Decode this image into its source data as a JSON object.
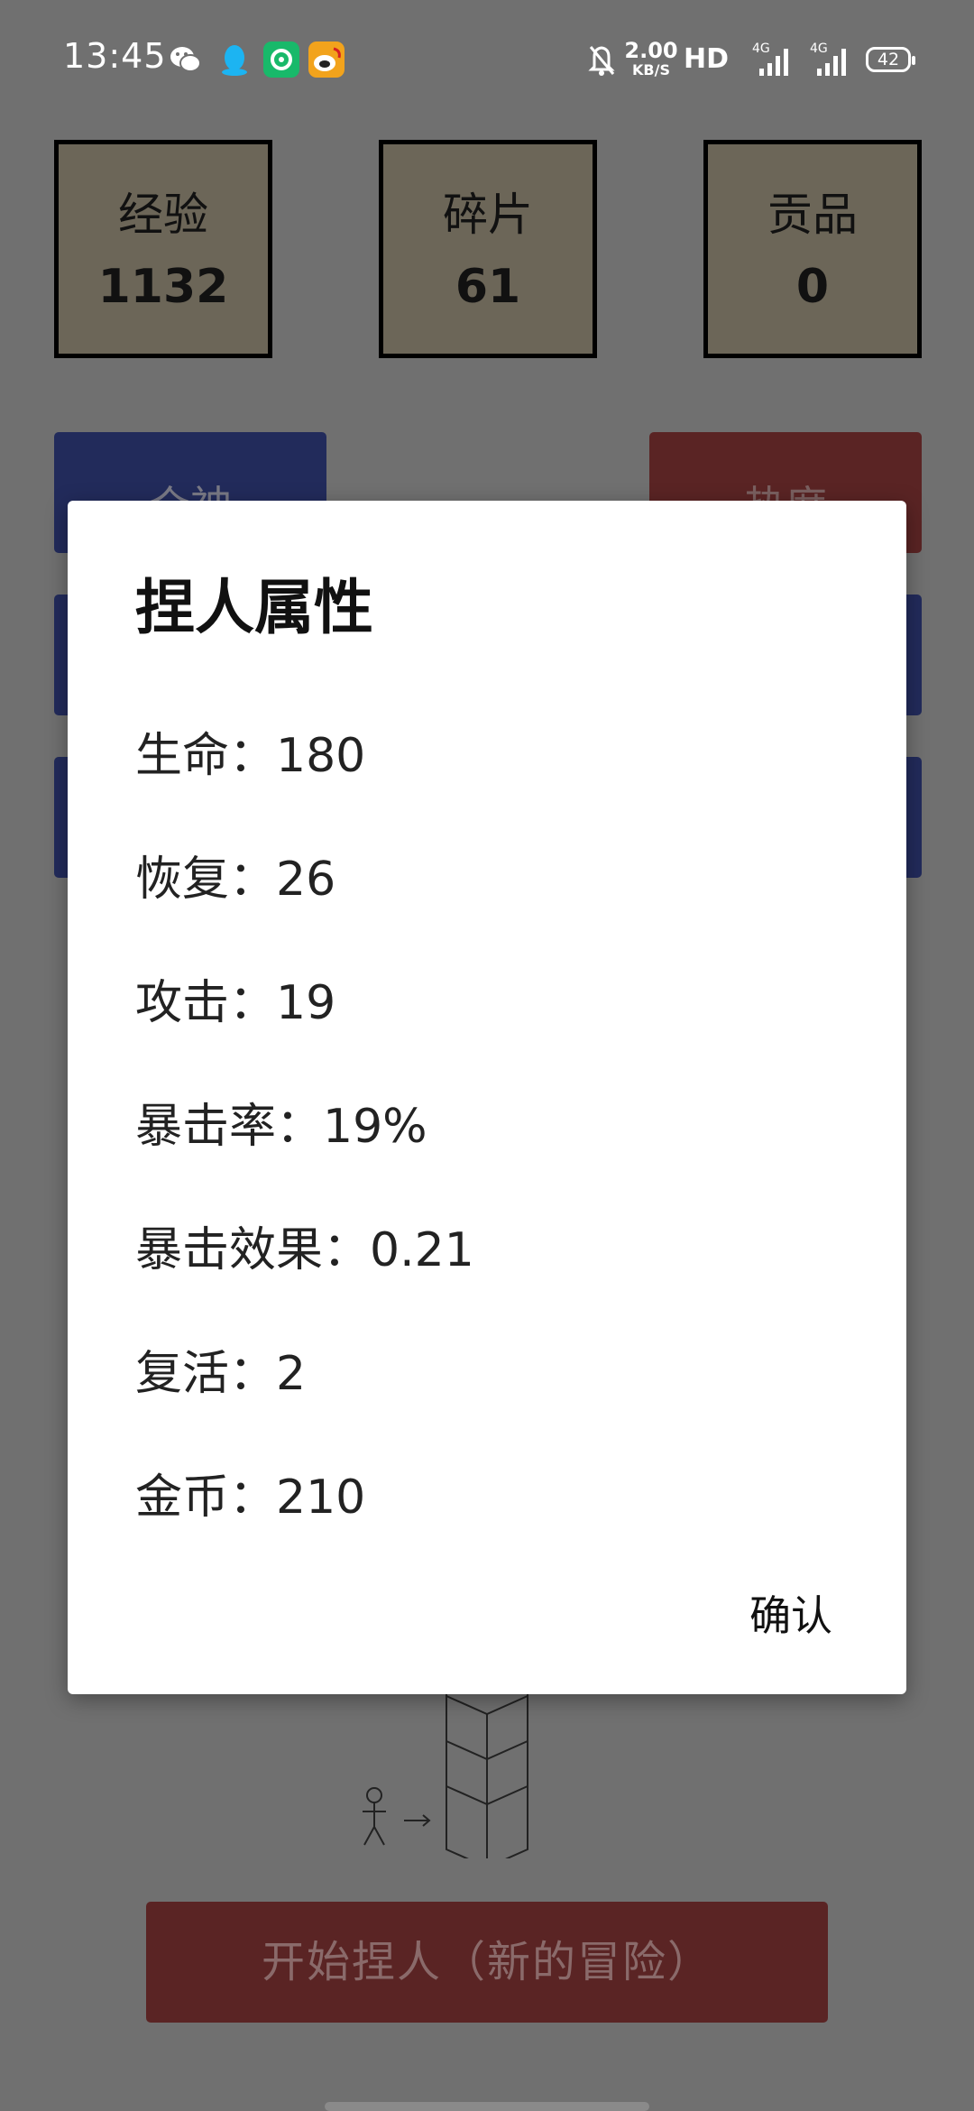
{
  "status_bar": {
    "time": "13:45",
    "apps": [
      "wechat-icon",
      "qq-icon",
      "green-app-icon",
      "weibo-icon"
    ],
    "network_speed": "2.00",
    "network_speed_unit": "KB/S",
    "hd": "HD",
    "signal_1": "4G",
    "signal_2": "4G",
    "battery": "42"
  },
  "stats": {
    "exp_label": "经验",
    "exp_value": "1132",
    "fragment_label": "碎片",
    "fragment_value": "61",
    "tribute_label": "贡品",
    "tribute_value": "0"
  },
  "buttons": {
    "gods": "众神",
    "heat": "热度",
    "start": "开始捏人（新的冒险）"
  },
  "dialog": {
    "title": "捏人属性",
    "attributes": [
      "生命：180",
      "恢复：26",
      "攻击：19",
      "暴击率：19%",
      "暴击效果：0.21",
      "复活：2",
      "金币：210"
    ],
    "confirm": "确认"
  },
  "colors": {
    "overlay_bg": "#707070",
    "stat_box_bg": "#6c6658",
    "blue_button": "#222b5b",
    "red_button": "#5a2424",
    "dialog_bg": "#ffffff"
  }
}
